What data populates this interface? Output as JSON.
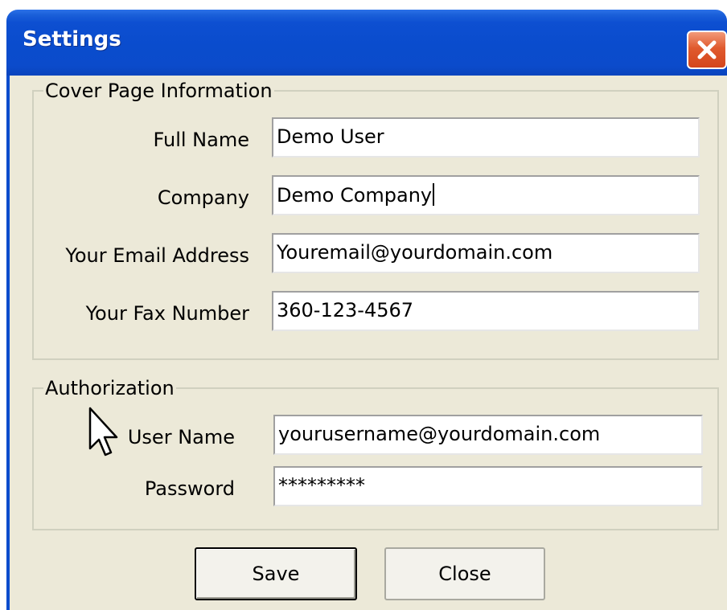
{
  "window": {
    "title": "Settings"
  },
  "cover_page": {
    "legend": "Cover Page Information",
    "fields": [
      {
        "label": "Full Name",
        "value": "Demo User"
      },
      {
        "label": "Company",
        "value": "Demo Company"
      },
      {
        "label": "Your Email Address",
        "value": "Youremail@yourdomain.com"
      },
      {
        "label": "Your Fax Number",
        "value": "360-123-4567"
      }
    ]
  },
  "authorization": {
    "legend": "Authorization",
    "username_label": "User Name",
    "username_value": "yourusername@yourdomain.com",
    "password_label": "Password",
    "password_value": "*********"
  },
  "buttons": {
    "save_label": "Save",
    "close_label": "Close"
  },
  "icons": {
    "close": "close-icon",
    "cursor": "mouse-pointer-icon"
  },
  "colors": {
    "titlebar": "#0a4ccd",
    "close_button": "#e05a2e",
    "dialog_background": "#ece9d8"
  }
}
